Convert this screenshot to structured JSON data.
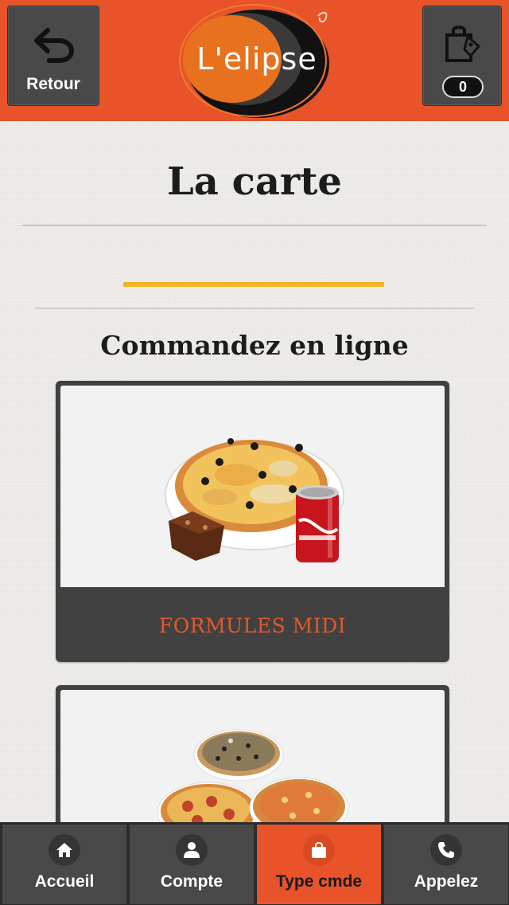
{
  "header": {
    "back_label": "Retour",
    "cart_count": "0",
    "logo_text_a": "L'e",
    "logo_text_b": "lip",
    "logo_text_c": "se",
    "brand_color": "#e8532a"
  },
  "page": {
    "title": "La carte",
    "subtitle": "Commandez en ligne"
  },
  "categories": [
    {
      "label": "FORMULES MIDI",
      "image": "pizza-coca-brownie"
    },
    {
      "label": "",
      "image": "three-pizzas"
    }
  ],
  "bottom_nav": [
    {
      "label": "Accueil",
      "icon": "home-icon",
      "active": false
    },
    {
      "label": "Compte",
      "icon": "user-icon",
      "active": false
    },
    {
      "label": "Type cmde",
      "icon": "bag-icon",
      "active": true
    },
    {
      "label": "Appelez",
      "icon": "phone-icon",
      "active": false
    }
  ]
}
